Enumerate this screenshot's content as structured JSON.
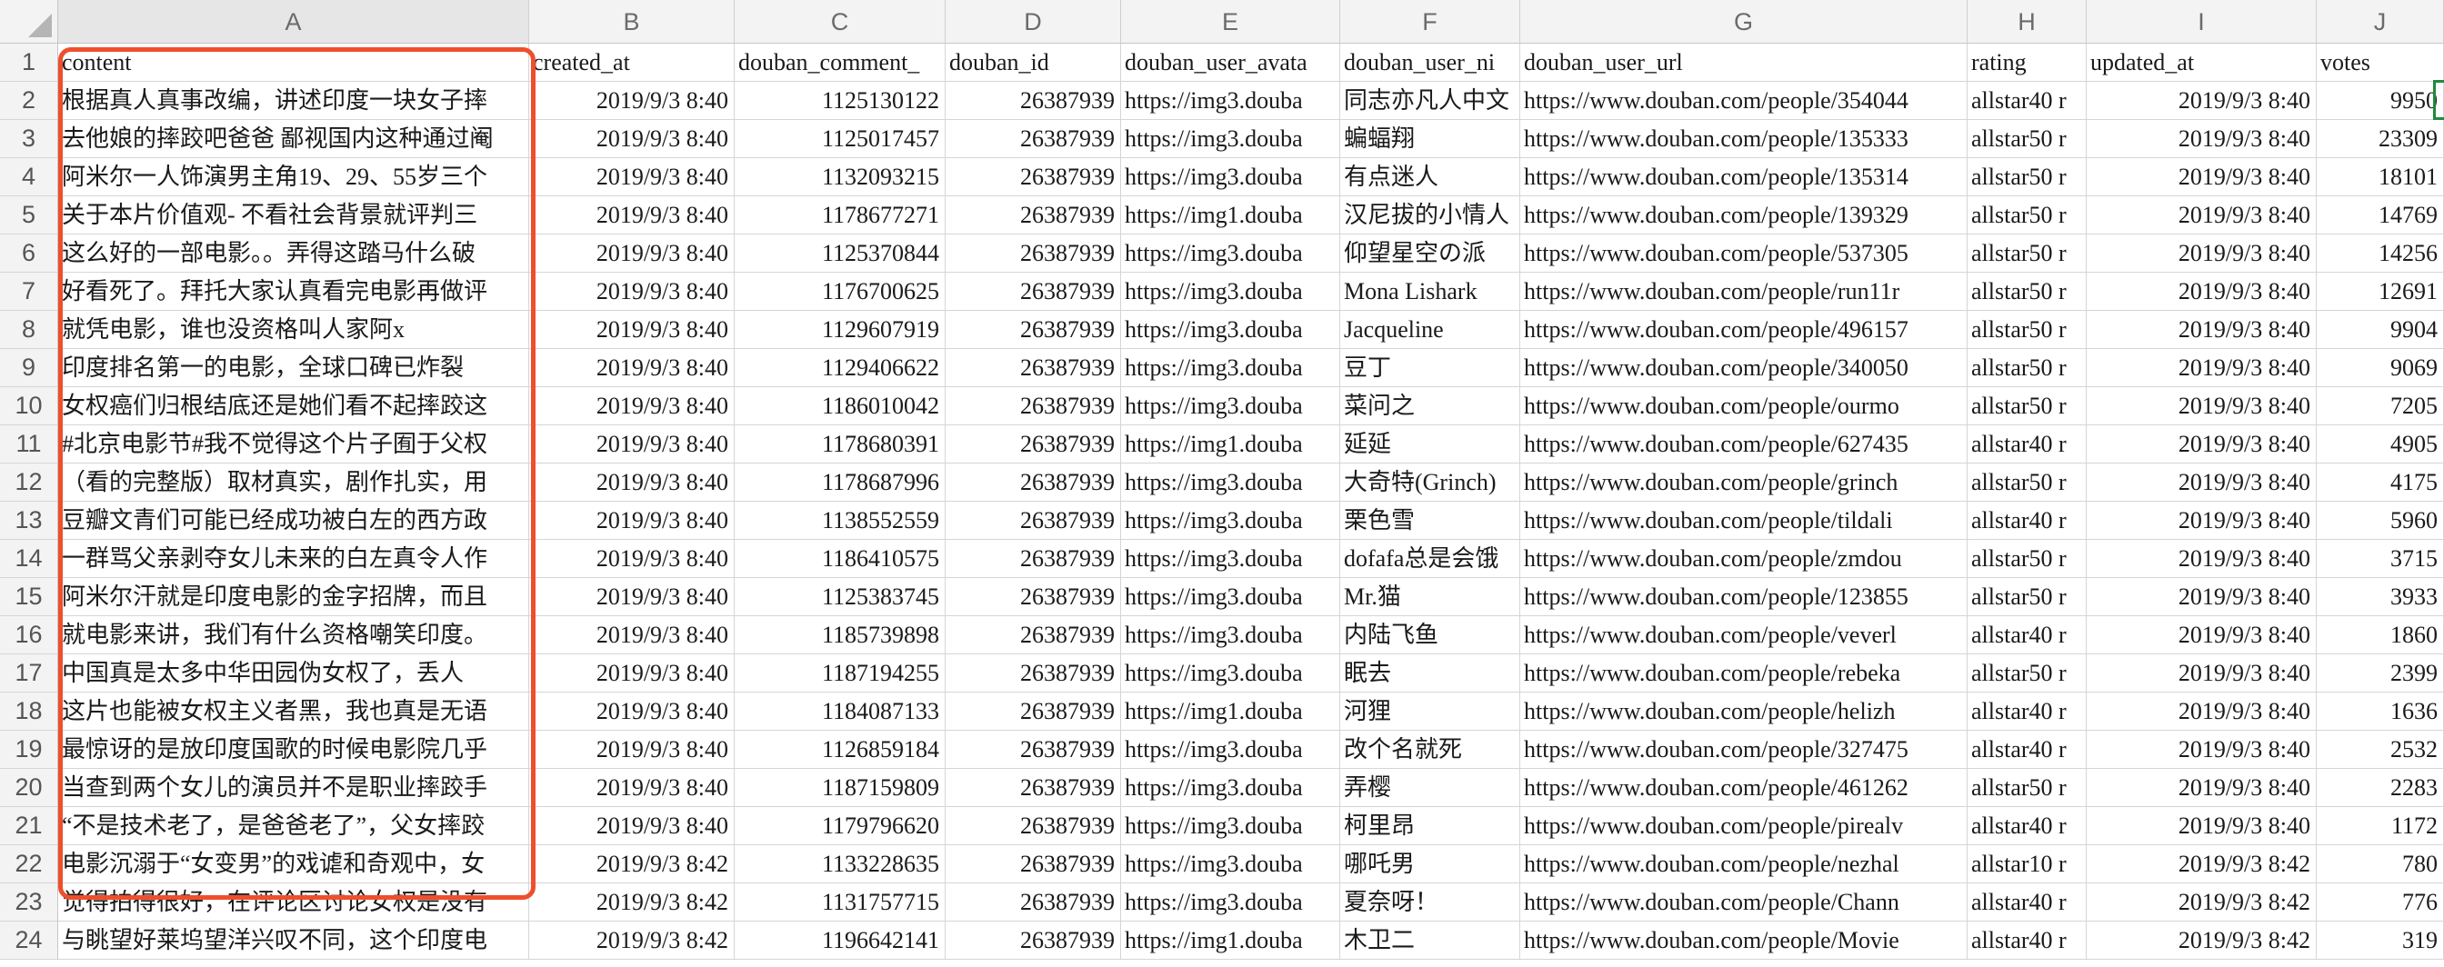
{
  "sheet": {
    "column_letters": [
      "A",
      "B",
      "C",
      "D",
      "E",
      "F",
      "G",
      "H",
      "I",
      "J"
    ],
    "headers": [
      "content",
      "created_at",
      "douban_comment_",
      "douban_id",
      "douban_user_avata",
      "douban_user_ni",
      "douban_user_url",
      "rating",
      "updated_at",
      "votes"
    ],
    "rows": [
      {
        "num": "2",
        "cells": [
          "根据真人真事改编，讲述印度一块女子摔",
          "2019/9/3 8:40",
          "1125130122",
          "26387939",
          "https://img3.douba",
          "同志亦凡人中文",
          "https://www.douban.com/people/354044",
          "allstar40 r",
          "2019/9/3 8:40",
          "9950"
        ]
      },
      {
        "num": "3",
        "cells": [
          "去他娘的摔跤吧爸爸 鄙视国内这种通过阉",
          "2019/9/3 8:40",
          "1125017457",
          "26387939",
          "https://img3.douba",
          "蝙蝠翔",
          "https://www.douban.com/people/135333",
          "allstar50 r",
          "2019/9/3 8:40",
          "23309"
        ]
      },
      {
        "num": "4",
        "cells": [
          "阿米尔一人饰演男主角19、29、55岁三个",
          "2019/9/3 8:40",
          "1132093215",
          "26387939",
          "https://img3.douba",
          "有点迷人",
          "https://www.douban.com/people/135314",
          "allstar50 r",
          "2019/9/3 8:40",
          "18101"
        ]
      },
      {
        "num": "5",
        "cells": [
          "关于本片价值观-  不看社会背景就评判三",
          "2019/9/3 8:40",
          "1178677271",
          "26387939",
          "https://img1.douba",
          "汉尼拔的小情人",
          "https://www.douban.com/people/139329",
          "allstar50 r",
          "2019/9/3 8:40",
          "14769"
        ]
      },
      {
        "num": "6",
        "cells": [
          "这么好的一部电影。。弄得这踏马什么破",
          "2019/9/3 8:40",
          "1125370844",
          "26387939",
          "https://img3.douba",
          "仰望星空の派",
          "https://www.douban.com/people/537305",
          "allstar50 r",
          "2019/9/3 8:40",
          "14256"
        ]
      },
      {
        "num": "7",
        "cells": [
          "好看死了。拜托大家认真看完电影再做评",
          "2019/9/3 8:40",
          "1176700625",
          "26387939",
          "https://img3.douba",
          "Mona Lishark",
          "https://www.douban.com/people/run11r",
          "allstar50 r",
          "2019/9/3 8:40",
          "12691"
        ]
      },
      {
        "num": "8",
        "cells": [
          "就凭电影，谁也没资格叫人家阿x",
          "2019/9/3 8:40",
          "1129607919",
          "26387939",
          "https://img3.douba",
          "Jacqueline",
          "https://www.douban.com/people/496157",
          "allstar50 r",
          "2019/9/3 8:40",
          "9904"
        ]
      },
      {
        "num": "9",
        "cells": [
          "印度排名第一的电影，全球口碑已炸裂",
          "2019/9/3 8:40",
          "1129406622",
          "26387939",
          "https://img3.douba",
          "豆丁",
          "https://www.douban.com/people/340050",
          "allstar50 r",
          "2019/9/3 8:40",
          "9069"
        ]
      },
      {
        "num": "10",
        "cells": [
          "女权癌们归根结底还是她们看不起摔跤这",
          "2019/9/3 8:40",
          "1186010042",
          "26387939",
          "https://img3.douba",
          "菜问之",
          "https://www.douban.com/people/ourmo",
          "allstar50 r",
          "2019/9/3 8:40",
          "7205"
        ]
      },
      {
        "num": "11",
        "cells": [
          "#北京电影节#我不觉得这个片子囿于父权",
          "2019/9/3 8:40",
          "1178680391",
          "26387939",
          "https://img1.douba",
          "延延",
          "https://www.douban.com/people/627435",
          "allstar40 r",
          "2019/9/3 8:40",
          "4905"
        ]
      },
      {
        "num": "12",
        "cells": [
          "（看的完整版）取材真实，剧作扎实，用",
          "2019/9/3 8:40",
          "1178687996",
          "26387939",
          "https://img3.douba",
          "大奇特(Grinch)",
          "https://www.douban.com/people/grinch",
          "allstar50 r",
          "2019/9/3 8:40",
          "4175"
        ]
      },
      {
        "num": "13",
        "cells": [
          "豆瓣文青们可能已经成功被白左的西方政",
          "2019/9/3 8:40",
          "1138552559",
          "26387939",
          "https://img3.douba",
          "栗色雪",
          "https://www.douban.com/people/tildali",
          "allstar40 r",
          "2019/9/3 8:40",
          "5960"
        ]
      },
      {
        "num": "14",
        "cells": [
          "一群骂父亲剥夺女儿未来的白左真令人作",
          "2019/9/3 8:40",
          "1186410575",
          "26387939",
          "https://img3.douba",
          "dofafa总是会饿",
          "https://www.douban.com/people/zmdou",
          "allstar50 r",
          "2019/9/3 8:40",
          "3715"
        ]
      },
      {
        "num": "15",
        "cells": [
          "阿米尔汗就是印度电影的金字招牌，而且",
          "2019/9/3 8:40",
          "1125383745",
          "26387939",
          "https://img3.douba",
          "Mr.猫",
          "https://www.douban.com/people/123855",
          "allstar50 r",
          "2019/9/3 8:40",
          "3933"
        ]
      },
      {
        "num": "16",
        "cells": [
          "就电影来讲，我们有什么资格嘲笑印度。",
          "2019/9/3 8:40",
          "1185739898",
          "26387939",
          "https://img3.douba",
          "内陆飞鱼",
          "https://www.douban.com/people/veverl",
          "allstar40 r",
          "2019/9/3 8:40",
          "1860"
        ]
      },
      {
        "num": "17",
        "cells": [
          "中国真是太多中华田园伪女权了，丢人",
          "2019/9/3 8:40",
          "1187194255",
          "26387939",
          "https://img3.douba",
          "眠去",
          "https://www.douban.com/people/rebeka",
          "allstar50 r",
          "2019/9/3 8:40",
          "2399"
        ]
      },
      {
        "num": "18",
        "cells": [
          "这片也能被女权主义者黑，我也真是无语",
          "2019/9/3 8:40",
          "1184087133",
          "26387939",
          "https://img1.douba",
          "河狸",
          "https://www.douban.com/people/helizh",
          "allstar40 r",
          "2019/9/3 8:40",
          "1636"
        ]
      },
      {
        "num": "19",
        "cells": [
          "最惊讶的是放印度国歌的时候电影院几乎",
          "2019/9/3 8:40",
          "1126859184",
          "26387939",
          "https://img3.douba",
          "改个名就死",
          "https://www.douban.com/people/327475",
          "allstar40 r",
          "2019/9/3 8:40",
          "2532"
        ]
      },
      {
        "num": "20",
        "cells": [
          "当查到两个女儿的演员并不是职业摔跤手",
          "2019/9/3 8:40",
          "1187159809",
          "26387939",
          "https://img3.douba",
          "弄樱",
          "https://www.douban.com/people/461262",
          "allstar50 r",
          "2019/9/3 8:40",
          "2283"
        ]
      },
      {
        "num": "21",
        "cells": [
          "“不是技术老了，是爸爸老了”，父女摔跤",
          "2019/9/3 8:40",
          "1179796620",
          "26387939",
          "https://img3.douba",
          "柯里昂",
          "https://www.douban.com/people/pirealv",
          "allstar40 r",
          "2019/9/3 8:40",
          "1172"
        ]
      },
      {
        "num": "22",
        "cells": [
          "电影沉溺于“女变男”的戏谑和奇观中，女",
          "2019/9/3 8:42",
          "1133228635",
          "26387939",
          "https://img3.douba",
          "哪吒男",
          "https://www.douban.com/people/nezhal",
          "allstar10 r",
          "2019/9/3 8:42",
          "780"
        ]
      },
      {
        "num": "23",
        "cells": [
          "觉得拍得很好，在评论区讨论女权是没有",
          "2019/9/3 8:42",
          "1131757715",
          "26387939",
          "https://img3.douba",
          "夏奈呀！",
          "https://www.douban.com/people/Chann",
          "allstar40 r",
          "2019/9/3 8:42",
          "776"
        ]
      },
      {
        "num": "24",
        "cells": [
          "与眺望好莱坞望洋兴叹不同，这个印度电",
          "2019/9/3 8:42",
          "1196642141",
          "26387939",
          "https://img1.douba",
          "木卫二",
          "https://www.douban.com/people/Movie",
          "allstar40 r",
          "2019/9/3 8:42",
          "319"
        ]
      }
    ]
  },
  "colors": {
    "highlight_border": "#ee4f2c",
    "selection_border": "#1f8a3d",
    "header_bg": "#f3f3f3",
    "grid_line": "#d5d5d5"
  }
}
